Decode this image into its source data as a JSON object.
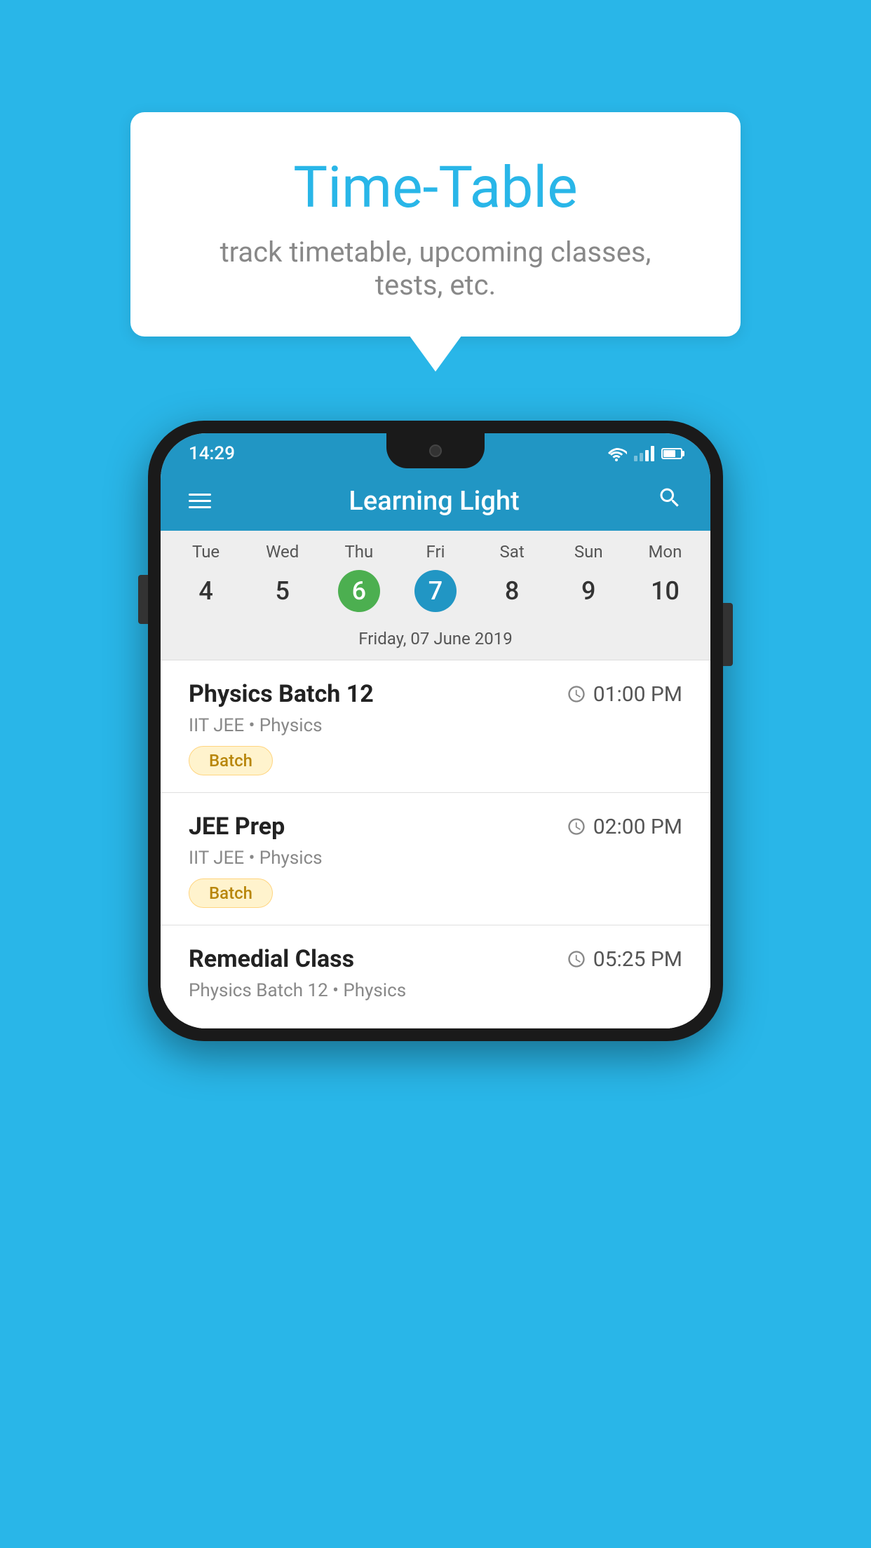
{
  "background": {
    "color": "#29b6e8"
  },
  "tooltip": {
    "title": "Time-Table",
    "subtitle": "track timetable, upcoming classes, tests, etc."
  },
  "phone": {
    "statusBar": {
      "time": "14:29"
    },
    "header": {
      "title": "Learning Light",
      "menuIcon": "hamburger-icon",
      "searchIcon": "search-icon"
    },
    "calendar": {
      "days": [
        {
          "name": "Tue",
          "number": "4",
          "state": "normal"
        },
        {
          "name": "Wed",
          "number": "5",
          "state": "normal"
        },
        {
          "name": "Thu",
          "number": "6",
          "state": "today"
        },
        {
          "name": "Fri",
          "number": "7",
          "state": "selected"
        },
        {
          "name": "Sat",
          "number": "8",
          "state": "normal"
        },
        {
          "name": "Sun",
          "number": "9",
          "state": "normal"
        },
        {
          "name": "Mon",
          "number": "10",
          "state": "normal"
        }
      ],
      "selectedDateLabel": "Friday, 07 June 2019"
    },
    "classes": [
      {
        "name": "Physics Batch 12",
        "time": "01:00 PM",
        "meta": "IIT JEE • Physics",
        "badge": "Batch"
      },
      {
        "name": "JEE Prep",
        "time": "02:00 PM",
        "meta": "IIT JEE • Physics",
        "badge": "Batch"
      },
      {
        "name": "Remedial Class",
        "time": "05:25 PM",
        "meta": "Physics Batch 12 • Physics",
        "badge": ""
      }
    ]
  }
}
